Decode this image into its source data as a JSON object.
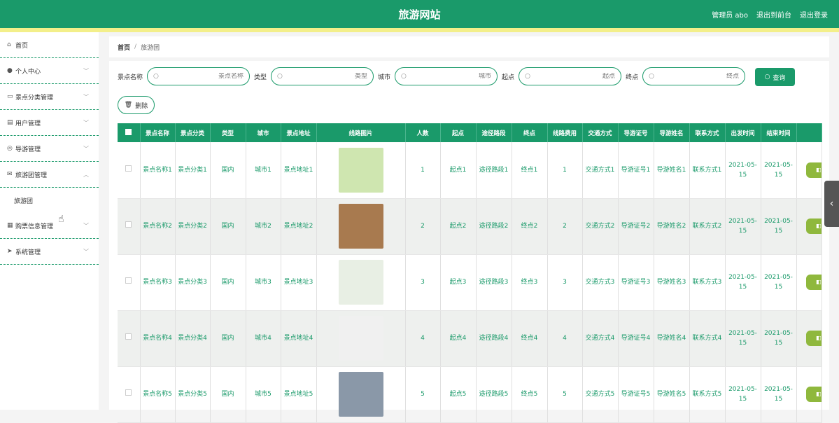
{
  "header": {
    "title": "旅游网站",
    "admin": "管理员 abo",
    "to_front": "退出到前台",
    "logout": "退出登录"
  },
  "sidebar": {
    "items": [
      {
        "label": "首页",
        "icon": "home-icon",
        "glyph": "⌂"
      },
      {
        "label": "个人中心",
        "icon": "user-icon",
        "glyph": "●",
        "chev": "﹀"
      },
      {
        "label": "景点分类管理",
        "icon": "monitor-icon",
        "glyph": "▭",
        "chev": "﹀"
      },
      {
        "label": "用户管理",
        "icon": "doc-icon",
        "glyph": "▤",
        "chev": "﹀"
      },
      {
        "label": "导游管理",
        "icon": "globe-icon",
        "glyph": "◎",
        "chev": "﹀"
      },
      {
        "label": "旅游团管理",
        "icon": "mail-icon",
        "glyph": "✉",
        "chev": "︿"
      },
      {
        "label": "购票信息管理",
        "icon": "grid-icon",
        "glyph": "▦",
        "chev": "﹀"
      },
      {
        "label": "系统管理",
        "icon": "send-icon",
        "glyph": "➤",
        "chev": "﹀"
      }
    ],
    "sub": "旅游团"
  },
  "breadcrumb": {
    "home": "首页",
    "sep": "/",
    "current": "旅游团"
  },
  "search": {
    "f1": {
      "label": "景点名称",
      "ph": "景点名称"
    },
    "f2": {
      "label": "类型",
      "ph": "类型"
    },
    "f3": {
      "label": "城市",
      "ph": "城市"
    },
    "f4": {
      "label": "起点",
      "ph": "起点"
    },
    "f5": {
      "label": "终点",
      "ph": "终点"
    },
    "query": "查询"
  },
  "delete_label": "删除",
  "columns": [
    "景点名称",
    "景点分类",
    "类型",
    "城市",
    "景点地址",
    "线路图片",
    "人数",
    "起点",
    "途径路段",
    "终点",
    "线路费用",
    "交通方式",
    "导游证号",
    "导游姓名",
    "联系方式",
    "出发时间",
    "结束时间"
  ],
  "rows": [
    [
      "景点名称1",
      "景点分类1",
      "国内",
      "城市1",
      "景点地址1",
      "",
      "1",
      "起点1",
      "途径路段1",
      "终点1",
      "1",
      "交通方式1",
      "导游证号1",
      "导游姓名1",
      "联系方式1",
      "2021-05-15",
      "2021-05-15"
    ],
    [
      "景点名称2",
      "景点分类2",
      "国内",
      "城市2",
      "景点地址2",
      "",
      "2",
      "起点2",
      "途径路段2",
      "终点2",
      "2",
      "交通方式2",
      "导游证号2",
      "导游姓名2",
      "联系方式2",
      "2021-05-15",
      "2021-05-15"
    ],
    [
      "景点名称3",
      "景点分类3",
      "国内",
      "城市3",
      "景点地址3",
      "",
      "3",
      "起点3",
      "途径路段3",
      "终点3",
      "3",
      "交通方式3",
      "导游证号3",
      "导游姓名3",
      "联系方式3",
      "2021-05-15",
      "2021-05-15"
    ],
    [
      "景点名称4",
      "景点分类4",
      "国内",
      "城市4",
      "景点地址4",
      "",
      "4",
      "起点4",
      "途径路段4",
      "终点4",
      "4",
      "交通方式4",
      "导游证号4",
      "导游姓名4",
      "联系方式4",
      "2021-05-15",
      "2021-05-15"
    ],
    [
      "景点名称5",
      "景点分类5",
      "国内",
      "城市5",
      "景点地址5",
      "",
      "5",
      "起点5",
      "途径路段5",
      "终点5",
      "5",
      "交通方式5",
      "导游证号5",
      "导游姓名5",
      "联系方式5",
      "2021-05-15",
      "2021-05-15"
    ]
  ],
  "pic_colors": [
    "#cfe6b0",
    "#a87a4f",
    "#e8efe4",
    "#f0f0f0",
    "#8a98a8"
  ],
  "colors": {
    "primary": "#1a9a6a",
    "accent": "#f3ef8a",
    "op": "#8fb83d"
  }
}
